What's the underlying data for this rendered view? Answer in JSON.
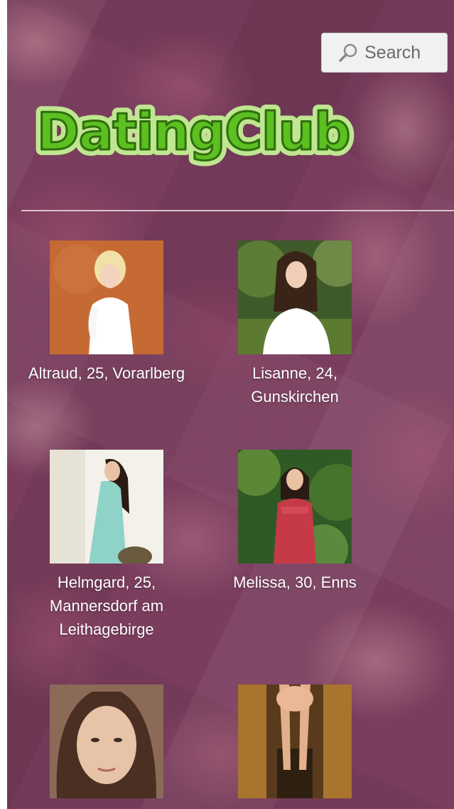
{
  "header": {
    "search_label": "Search",
    "logo_text": "DatingClub"
  },
  "colors": {
    "background": "#7a3d5e",
    "logo_green": "#5cc021",
    "logo_outline": "#2f6e0e",
    "text": "#ffffff"
  },
  "profiles": [
    {
      "caption": "Altraud, 25, Vorarlberg"
    },
    {
      "caption": "Lisanne, 24, Gunskirchen"
    },
    {
      "caption": "Helmgard, 25, Mannersdorf am Leithagebirge"
    },
    {
      "caption": "Melissa, 30, Enns"
    },
    {
      "caption": ""
    },
    {
      "caption": ""
    }
  ]
}
